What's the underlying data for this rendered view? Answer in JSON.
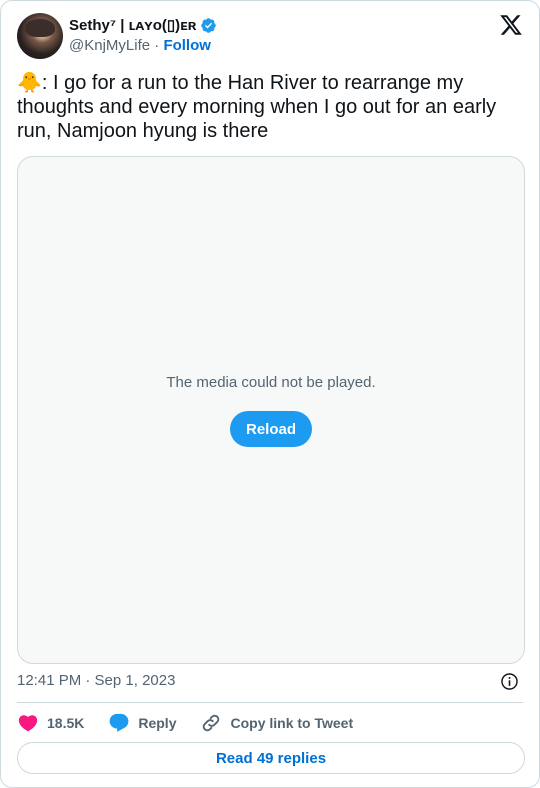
{
  "author": {
    "display_name": "Sethy⁷ | ʟᴀʏᴏ(▯)ᴇʀ",
    "handle": "@KnjMyLife",
    "separator": "·",
    "follow_label": "Follow"
  },
  "tweet": {
    "text": "🐥: I go for a run to the Han River to rearrange my thoughts and every morning when I go out for an early run, Namjoon hyung is there"
  },
  "media": {
    "error_message": "The media could not be played.",
    "reload_label": "Reload"
  },
  "meta": {
    "timestamp": "12:41 PM · Sep 1, 2023"
  },
  "actions": {
    "likes_count": "18.5K",
    "reply_label": "Reply",
    "copy_link_label": "Copy link to Tweet"
  },
  "footer": {
    "read_replies_label": "Read 49 replies"
  },
  "colors": {
    "accent": "#1d9bf0",
    "link": "#006fd6",
    "like": "#f91880",
    "text_secondary": "#536471"
  },
  "icons": [
    "verified-badge-icon",
    "x-logo-icon",
    "info-icon",
    "heart-icon",
    "reply-bubble-icon",
    "link-icon"
  ]
}
